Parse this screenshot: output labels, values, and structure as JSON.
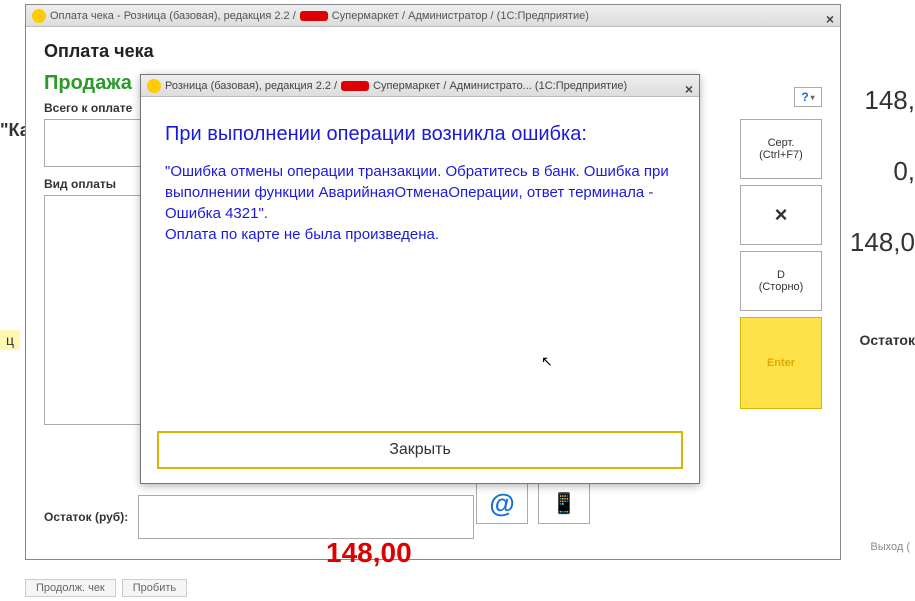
{
  "bg": {
    "left_label": "\"Ка",
    "small_label": "ц",
    "ostatok_label": "Остаток",
    "exit_label": "Выход (",
    "val1": "148,",
    "val2": "0,",
    "val3": "148,0",
    "bottom1": "Продолж. чек",
    "bottom2": "Пробить"
  },
  "main": {
    "title_prefix": "Оплата чека - Розница (базовая), редакция 2.2 /",
    "title_suffix": "Супермаркет / Администратор /  (1С:Предприятие)",
    "h_title": "Оплата чека",
    "h_sale": "Продажа",
    "label_total": "Всего к оплате",
    "label_paytype": "Вид оплаты",
    "label_ostatok": "Остаток (руб):",
    "amount": "148,00",
    "at_symbol": "@",
    "phone_symbol": "📱",
    "help_symbol": "?",
    "btn_cert_l1": "Серт.",
    "btn_cert_l2": "(Ctrl+F7)",
    "btn_x": "×",
    "btn_storno_l1": "D",
    "btn_storno_l2": "(Сторно)",
    "btn_enter": "Enter"
  },
  "dlg": {
    "title_prefix": "Розница (базовая), редакция 2.2 /",
    "title_suffix": "Супермаркет / Администрато...  (1С:Предприятие)",
    "heading": "При выполнении операции возникла ошибка:",
    "body1": "\"Ошибка отмены операции транзакции. Обратитесь в банк. Ошибка при выполнении функции АварийнаяОтменаОперации, ответ терминала - Ошибка 4321\".",
    "body2": "Оплата по карте не была произведена.",
    "close": "Закрыть"
  }
}
